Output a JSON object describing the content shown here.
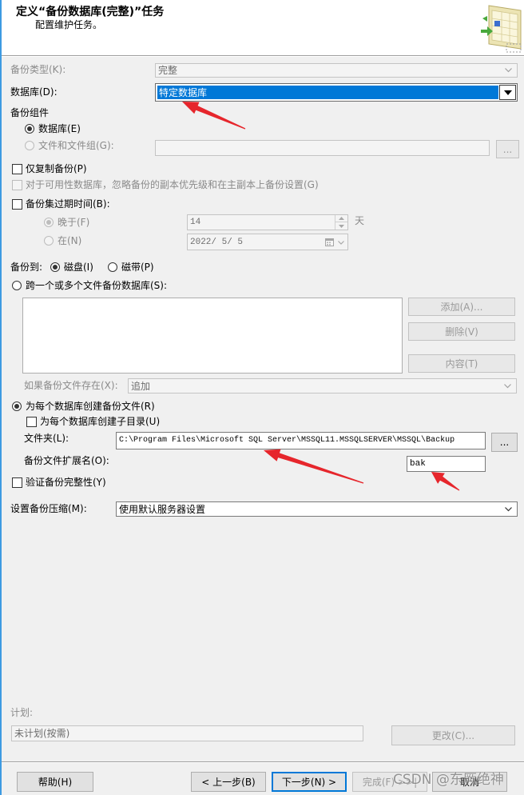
{
  "header": {
    "title": "定义“备份数据库(完整)”任务",
    "subtitle": "配置维护任务。",
    "icon": "backup-task-icon"
  },
  "backup_type": {
    "label": "备份类型(K):",
    "value": "完整",
    "disabled": true
  },
  "database": {
    "label": "数据库(D):",
    "value": "特定数据库"
  },
  "components": {
    "heading": "备份组件",
    "database": {
      "label": "数据库(E)",
      "checked": true
    },
    "files": {
      "label": "文件和文件组(G):",
      "checked": false,
      "disabled": true,
      "value": "",
      "browse_label": "..."
    }
  },
  "copy_only": {
    "label": "仅复制备份(P)",
    "checked": false
  },
  "availability": {
    "label": "对于可用性数据库，忽略备份的副本优先级和在主副本上备份设置(G)",
    "checked": false,
    "disabled": true
  },
  "expire": {
    "label": "备份集过期时间(B):",
    "checked": false,
    "after": {
      "label": "晚于(F)",
      "checked": true,
      "disabled": true,
      "days": "14",
      "unit": "天"
    },
    "on": {
      "label": "在(N)",
      "checked": false,
      "disabled": true,
      "date": "2022/ 5/ 5"
    }
  },
  "backup_to": {
    "label": "备份到:",
    "disk": {
      "label": "磁盘(I)",
      "checked": true
    },
    "tape": {
      "label": "磁带(P)",
      "checked": false
    }
  },
  "span_files": {
    "label": "跨一个或多个文件备份数据库(S):",
    "checked": false,
    "files": [],
    "add_label": "添加(A)...",
    "remove_label": "删除(V)",
    "contents_label": "内容(T)",
    "buttons_disabled": true
  },
  "if_exists": {
    "label": "如果备份文件存在(X):",
    "value": "追加",
    "disabled": true
  },
  "per_database": {
    "label": "为每个数据库创建备份文件(R)",
    "checked": true,
    "subdir": {
      "label": "为每个数据库创建子目录(U)",
      "checked": false
    }
  },
  "folder": {
    "label": "文件夹(L):",
    "value": "C:\\Program Files\\Microsoft SQL Server\\MSSQL11.MSSQLSERVER\\MSSQL\\Backup",
    "browse_label": "..."
  },
  "extension": {
    "label": "备份文件扩展名(O):",
    "value": "bak"
  },
  "verify": {
    "label": "验证备份完整性(Y)",
    "checked": false
  },
  "compression": {
    "label": "设置备份压缩(M):",
    "value": "使用默认服务器设置"
  },
  "schedule": {
    "label": "计划:",
    "value": "未计划(按需)",
    "change_label": "更改(C)...",
    "disabled": true
  },
  "footer": {
    "help": "帮助(H)",
    "back": "< 上一步(B)",
    "next": "下一步(N) >",
    "finish": "完成(F) >>|",
    "cancel": "取消",
    "finish_disabled": true
  },
  "watermark": "CSDN @东厥绝神",
  "colors": {
    "selection": "#0078d7",
    "focus": "#0078d7",
    "annotation": "#e6262c",
    "window_edge": "#3d9ae2"
  }
}
